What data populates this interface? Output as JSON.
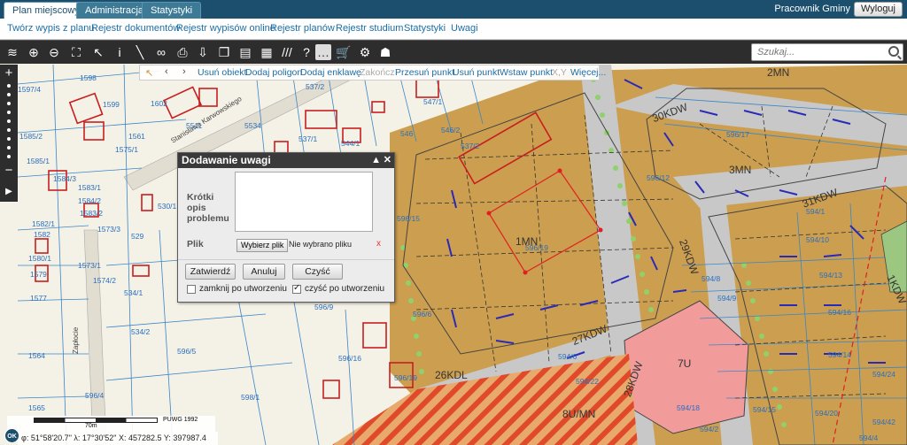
{
  "tabs": [
    {
      "label": "Plan miejscowy",
      "active": true
    },
    {
      "label": "Administracja",
      "active": false
    },
    {
      "label": "Statystyki",
      "active": false
    }
  ],
  "user": "Pracownik Gminy",
  "logout": "Wyloguj",
  "menu": [
    "Twórz wypis z planu",
    "Rejestr dokumentów",
    "Rejestr wypisów online",
    "Rejestr planów",
    "Rejestr studium",
    "Statystyki",
    "Uwagi"
  ],
  "toolbar_icons": [
    "layers-icon",
    "zoom-in-icon",
    "zoom-out-icon",
    "zoom-extent-icon",
    "select-icon",
    "info-icon",
    "measure-icon",
    "link-icon",
    "print-icon",
    "download-icon",
    "copy-icon",
    "layout-icon",
    "grid-icon",
    "hatch-icon",
    "help-icon",
    "more-icon",
    "cart-icon",
    "settings-icon",
    "user-map-icon"
  ],
  "search": {
    "placeholder": "Szukaj..."
  },
  "edit_bar": [
    "Usuń obiekt",
    "Dodaj poligon",
    "Dodaj enklawę",
    "Zakończ",
    "Przesuń punkt",
    "Usuń punkt",
    "Wstaw punkt",
    "X,Y",
    "Więcej..."
  ],
  "edit_disabled": [
    false,
    false,
    false,
    true,
    false,
    false,
    false,
    true,
    false
  ],
  "dialog": {
    "title": "Dodawanie uwagi",
    "desc_label": "Krótki opis problemu",
    "file_label": "Plik",
    "file_button": "Wybierz plik",
    "file_name": "Nie wybrano pliku",
    "submit": "Zatwierdź",
    "cancel": "Anuluj",
    "clear": "Czyść",
    "close_after": "zamknij po utworzeniu",
    "close_after_checked": false,
    "clear_after": "czyść po utworzeniu",
    "clear_after_checked": true
  },
  "scale": {
    "label": "70m",
    "crs": "PUWG 1992"
  },
  "coords": {
    "lat": "φ: 51°58'20.7\"",
    "lon": "λ: 17°30'52\"",
    "x": "X: 457282.5",
    "y": "Y: 397987.4"
  },
  "map": {
    "streets": [
      "Stanisława Karwowskiego",
      "Zapłocie"
    ],
    "zones": [
      "2MN",
      "3MN",
      "1MN",
      "7U",
      "26KDL",
      "27KDW",
      "28KDW",
      "29KDW",
      "30KDW",
      "31KDW",
      "8U/MN",
      "1KDW"
    ],
    "parcels": [
      "1598",
      "1599",
      "1602",
      "5511",
      "5534",
      "537/2",
      "546",
      "546/2",
      "547/1",
      "537/1",
      "544/1",
      "1585/2",
      "1585/1",
      "1584/3",
      "1584/2",
      "1583/2",
      "1582/1",
      "1582",
      "1580/1",
      "1579",
      "1573/1",
      "1573/2",
      "1573/3",
      "1574/2",
      "1577",
      "529",
      "534/1",
      "534/2",
      "1564",
      "1565",
      "596/5",
      "596/4",
      "598/1",
      "596/16",
      "596/19",
      "596/9",
      "596/6",
      "596/15",
      "596/12",
      "596/17",
      "594/1",
      "594/10",
      "594/13",
      "594/16",
      "594/14",
      "594/8",
      "594/9",
      "594/6",
      "594/18",
      "594/22",
      "594/15",
      "594/20",
      "594/24",
      "594/42",
      "594/2",
      "594/4",
      "1597/4",
      "1575/1",
      "1561",
      "1583/1",
      "530/1",
      "596/19"
    ]
  }
}
